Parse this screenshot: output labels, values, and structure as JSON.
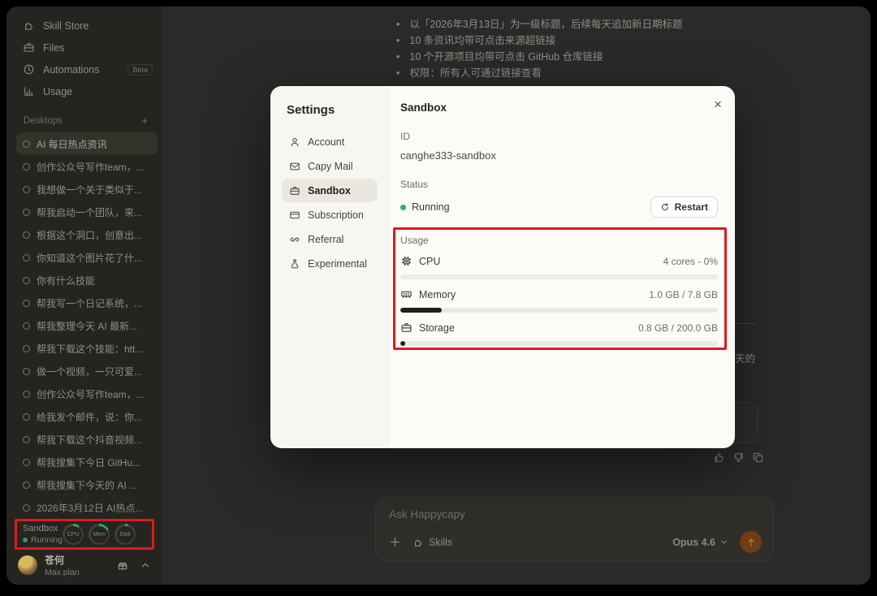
{
  "colors": {
    "annotation_red": "#dd1b1b",
    "running_green": "#27b55e",
    "send_orange": "#6e3d14"
  },
  "app": {
    "sidebar": {
      "nav": [
        {
          "label": "Skill Store",
          "icon": "puzzle-icon"
        },
        {
          "label": "Files",
          "icon": "toolbox-icon"
        },
        {
          "label": "Automations",
          "icon": "clock-icon",
          "badge": "Beta"
        },
        {
          "label": "Usage",
          "icon": "chart-icon"
        }
      ],
      "desktops_header": "Desktops",
      "desktops_add": "+",
      "selected_chat_index": 0,
      "chats": [
        "AI 每日热点资讯",
        "创作公众号写作team，...",
        "我想做一个关于类似于...",
        "帮我启动一个团队，来...",
        "根据这个洞口，创意出...",
        "你知道这个图片花了什...",
        "你有什么技能",
        "帮我写一个日记系统，...",
        "帮我整理今天 AI 最新...",
        "帮我下载这个技能：htt...",
        "做一个视频，一只可爱...",
        "创作公众号写作team，...",
        "给我发个邮件，说：你...",
        "帮我下载这个抖音视频...",
        "帮我搜集下今日 GitHu...",
        "帮我搜集下今天的 AI ...",
        "2026年3月12日 AI热点..."
      ],
      "sandbox_widget": {
        "title": "Sandbox",
        "status": "Running",
        "gauges": [
          {
            "label": "CPU",
            "arc": 10
          },
          {
            "label": "Mem",
            "arc": 18
          },
          {
            "label": "Disk",
            "arc": 5
          }
        ]
      },
      "user": {
        "name": "苍何",
        "plan": "Max plan"
      }
    },
    "chat": {
      "bullets": [
        "以「2026年3月13日」为一级标题，后续每天追加新日期标题",
        "10 条资讯均带可点击来源超链接",
        "10 个开源项目均带可点击 GitHub 仓库链接",
        "权限：所有人可通过链接查看"
      ],
      "partial_text": "天的",
      "composer": {
        "placeholder": "Ask Happycapy",
        "skills_label": "Skills",
        "model": "Opus 4.6"
      }
    }
  },
  "modal": {
    "title": "Settings",
    "close": "×",
    "nav": [
      {
        "label": "Account",
        "icon": "person-icon"
      },
      {
        "label": "Capy Mail",
        "icon": "mail-icon"
      },
      {
        "label": "Sandbox",
        "icon": "toolbox-icon",
        "selected": true
      },
      {
        "label": "Subscription",
        "icon": "card-icon"
      },
      {
        "label": "Referral",
        "icon": "link-icon"
      },
      {
        "label": "Experimental",
        "icon": "flask-icon"
      }
    ],
    "panel": {
      "title": "Sandbox",
      "id_label": "ID",
      "id_value": "canghe333-sandbox",
      "status_label": "Status",
      "status_value": "Running",
      "restart_label": "Restart",
      "usage_label": "Usage",
      "usage_rows": [
        {
          "label": "CPU",
          "icon": "cpu-icon",
          "value": "4 cores - 0%",
          "percent": 0
        },
        {
          "label": "Memory",
          "icon": "memory-icon",
          "value": "1.0 GB / 7.8 GB",
          "percent": 13
        },
        {
          "label": "Storage",
          "icon": "storage-icon",
          "value": "0.8 GB / 200.0 GB",
          "percent": 1.5
        }
      ]
    }
  }
}
